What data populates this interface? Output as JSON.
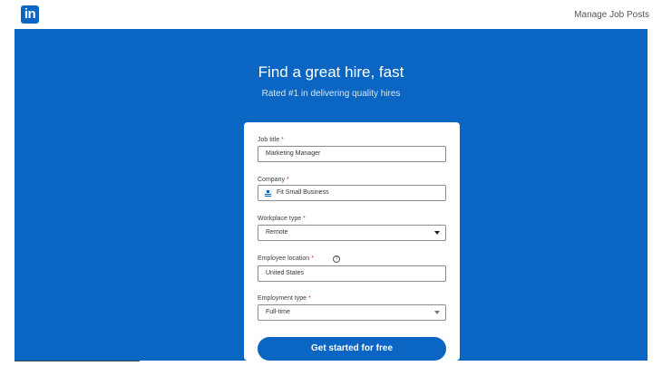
{
  "header": {
    "logo_text": "in",
    "manage_link": "Manage Job Posts"
  },
  "hero": {
    "title": "Find a great hire, fast",
    "subtitle": "Rated #1 in delivering quality hires"
  },
  "form": {
    "job_title": {
      "label": "Job title",
      "required_mark": "*",
      "value": "Marketing Manager"
    },
    "company": {
      "label": "Company",
      "required_mark": "*",
      "value": "Fit Small Business",
      "icon": "building-icon"
    },
    "workplace_type": {
      "label": "Workplace type",
      "required_mark": "*",
      "value": "Remote"
    },
    "employee_location": {
      "label": "Employee location",
      "required_mark": "*",
      "help_icon": "?",
      "value": "United States"
    },
    "employment_type": {
      "label": "Employment type",
      "required_mark": "*",
      "value": "Full-time"
    },
    "submit_label": "Get started for free"
  },
  "colors": {
    "brand_blue": "#0a66c2",
    "required_red": "#c43a2c"
  }
}
